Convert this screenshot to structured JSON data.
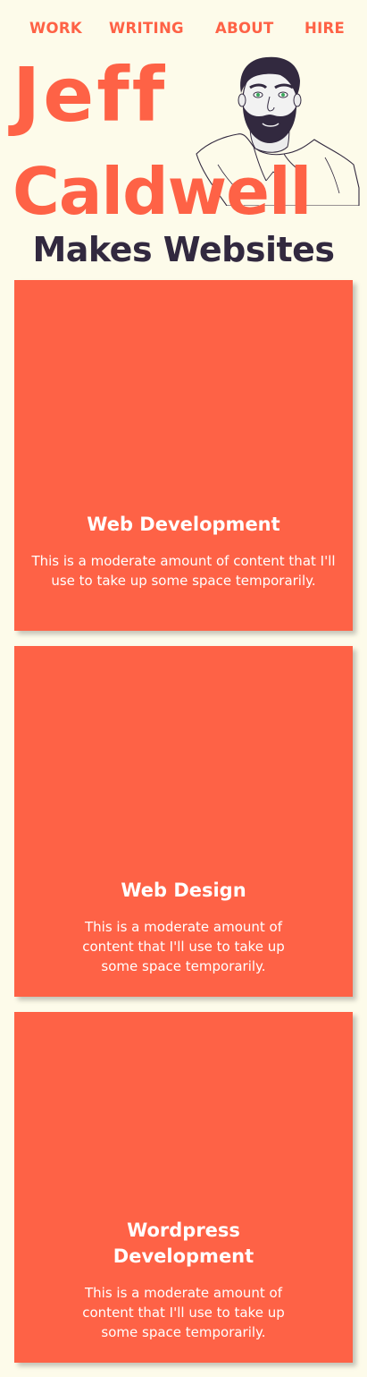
{
  "nav": {
    "items": [
      "WORK",
      "WRITING",
      "ABOUT",
      "HIRE"
    ]
  },
  "hero": {
    "first_name": "Jeff",
    "last_name": "Caldwell",
    "tagline": "Makes Websites",
    "portrait_icon": "portrait-illustration"
  },
  "colors": {
    "accent": "#fe6246",
    "background": "#fdfbea",
    "dark": "#32293f",
    "card_text": "#ffffff"
  },
  "services": [
    {
      "title": "Web Development",
      "text": "This is a moderate amount of content that I'll use to take up some space temporarily."
    },
    {
      "title": "Web Design",
      "text": "This is a moderate amount of content that I'll use to take up some space temporarily."
    },
    {
      "title": "Wordpress Development",
      "text": "This is a moderate amount of content that I'll use to take up some space temporarily."
    }
  ]
}
